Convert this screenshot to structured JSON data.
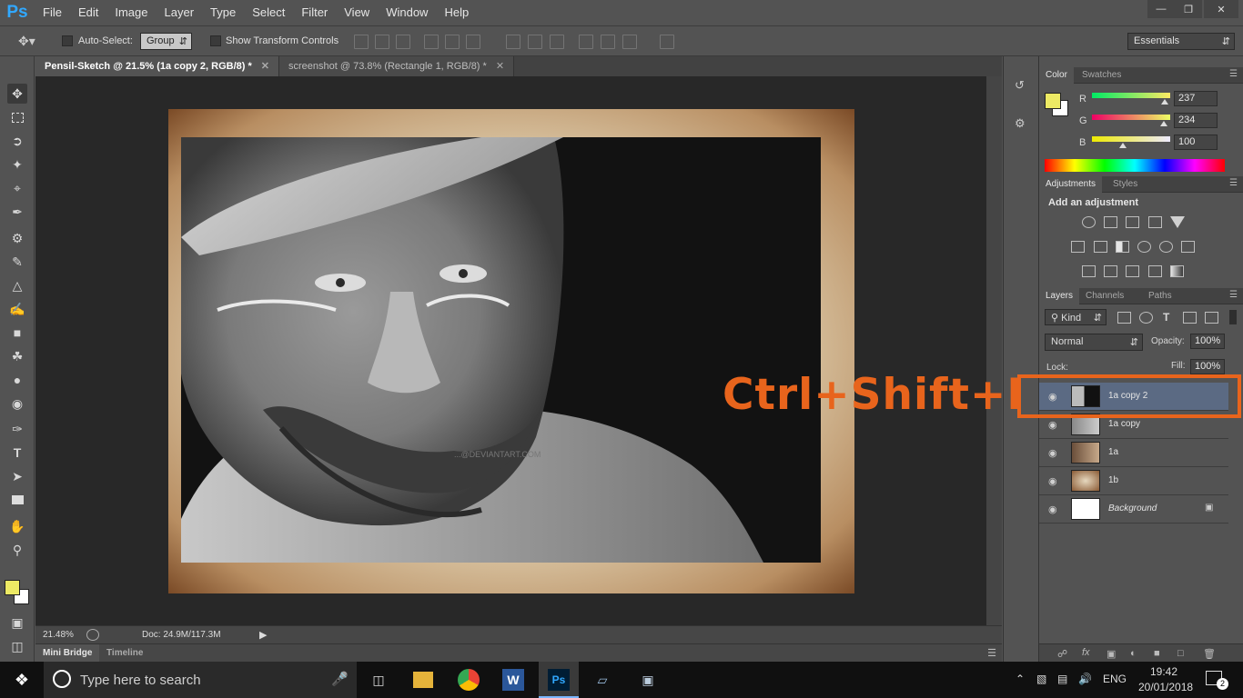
{
  "app": {
    "logo": "Ps",
    "menu": [
      "File",
      "Edit",
      "Image",
      "Layer",
      "Type",
      "Select",
      "Filter",
      "View",
      "Window",
      "Help"
    ],
    "window_controls": [
      "minimize-icon",
      "restore-icon",
      "close-icon"
    ]
  },
  "options": {
    "auto_select_label": "Auto-Select:",
    "auto_select_value": "Group",
    "show_transform_label": "Show Transform Controls",
    "workspace": "Essentials"
  },
  "tools": [
    "move-icon",
    "marquee-icon",
    "lasso-icon",
    "magic-wand-icon",
    "crop-icon",
    "eyedropper-icon",
    "healing-brush-icon",
    "brush-icon",
    "clone-stamp-icon",
    "history-brush-icon",
    "eraser-icon",
    "paint-bucket-icon",
    "blur-icon",
    "dodge-icon",
    "pen-icon",
    "type-icon",
    "path-select-icon",
    "rectangle-icon",
    "hand-icon",
    "zoom-icon"
  ],
  "doc_tabs": [
    {
      "label": "Pensil-Sketch @ 21.5% (1a copy 2, RGB/8) *",
      "active": true
    },
    {
      "label": "screenshot @ 73.8% (Rectangle 1, RGB/8) *",
      "active": false
    }
  ],
  "status": {
    "zoom": "21.48%",
    "doc": "Doc: 24.9M/117.3M"
  },
  "bottom_tabs": [
    "Mini Bridge",
    "Timeline"
  ],
  "color_panel": {
    "tabs": [
      "Color",
      "Swatches"
    ],
    "foreground": "#EDEA64",
    "channels": [
      {
        "label": "R",
        "value": "237",
        "fraction": 0.93
      },
      {
        "label": "G",
        "value": "234",
        "fraction": 0.92
      },
      {
        "label": "B",
        "value": "100",
        "fraction": 0.39
      }
    ]
  },
  "adjustments": {
    "tabs": [
      "Adjustments",
      "Styles"
    ],
    "heading": "Add an adjustment"
  },
  "layers_panel": {
    "tabs": [
      "Layers",
      "Channels",
      "Paths"
    ],
    "kind": "Kind",
    "blend_mode": "Normal",
    "opacity_label": "Opacity:",
    "opacity": "100%",
    "lock_label": "Lock:",
    "fill_label": "Fill:",
    "fill": "100%",
    "layers": [
      {
        "name": "1a copy 2",
        "selected": true
      },
      {
        "name": "1a copy",
        "selected": false
      },
      {
        "name": "1a",
        "selected": false
      },
      {
        "name": "1b",
        "selected": false
      },
      {
        "name": "Background",
        "selected": false
      }
    ]
  },
  "canvas": {
    "watermark": "...@DEVIANTART.COM"
  },
  "overlay": {
    "shortcut": "Ctrl+Shift+I",
    "accent": "#E8641C"
  },
  "taskbar": {
    "search_placeholder": "Type here to search",
    "language": "ENG",
    "time": "19:42",
    "date": "20/01/2018",
    "notification_count": "2"
  }
}
